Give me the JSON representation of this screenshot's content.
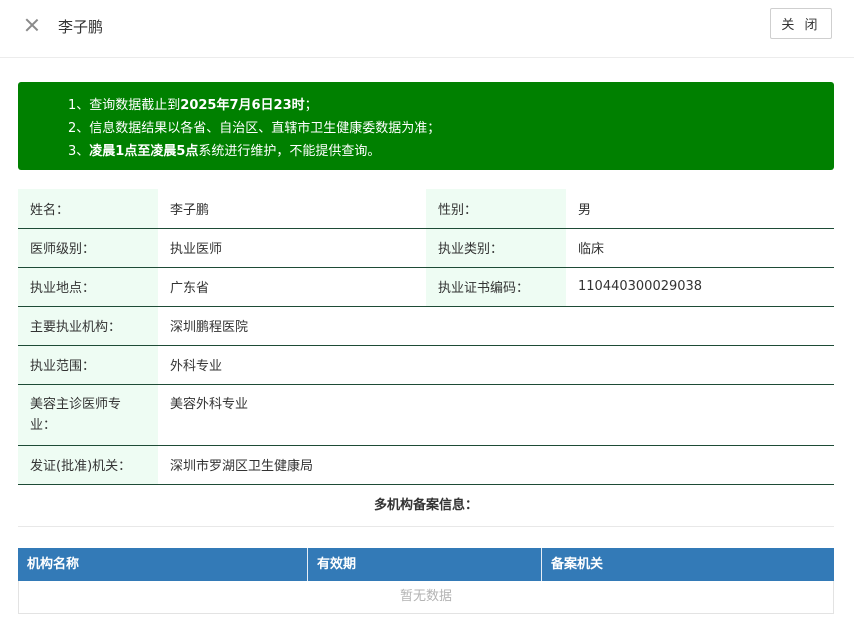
{
  "header": {
    "title": "李子鹏",
    "close_button": "关 闭"
  },
  "notice": {
    "line1_prefix": "1、查询数据截止到",
    "line1_bold": "2025年7月6日23时",
    "line1_suffix": "；",
    "line2": "2、信息数据结果以各省、自治区、直辖市卫生健康委数据为准；",
    "line3_prefix": "3、",
    "line3_bold": "凌晨1点至凌晨5点",
    "line3_suffix": "系统进行维护，不能提供查询。"
  },
  "info": {
    "name_label": "姓名：",
    "name_value": "李子鹏",
    "gender_label": "性别：",
    "gender_value": "男",
    "level_label": "医师级别：",
    "level_value": "执业医师",
    "category_label": "执业类别：",
    "category_value": "临床",
    "location_label": "执业地点：",
    "location_value": "广东省",
    "cert_label": "执业证书编码：",
    "cert_value": "110440300029038",
    "institution_label": "主要执业机构：",
    "institution_value": "深圳鹏程医院",
    "scope_label": "执业范围：",
    "scope_value": "外科专业",
    "cosmetic_label": "美容主诊医师专业：",
    "cosmetic_value": "美容外科专业",
    "authority_label": "发证(批准)机关：",
    "authority_value": "深圳市罗湖区卫生健康局"
  },
  "multi": {
    "title": "多机构备案信息：",
    "columns": [
      "机构名称",
      "有效期",
      "备案机关"
    ],
    "empty_text": "暂无数据"
  }
}
